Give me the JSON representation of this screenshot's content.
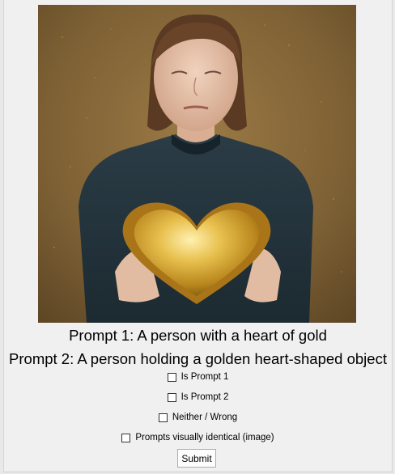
{
  "image": {
    "alt": ""
  },
  "prompts": {
    "prompt1": "Prompt 1: A person with a heart of gold",
    "prompt2": "Prompt 2: A person holding a golden heart-shaped object"
  },
  "options": {
    "is_prompt_1": "Is Prompt 1",
    "is_prompt_2": "Is Prompt 2",
    "neither": "Neither / Wrong",
    "identical": "Prompts visually identical (image)"
  },
  "submit_label": "Submit",
  "colors": {
    "background": "#f0f0f0",
    "gold": "#d9a93a",
    "sweater": "#24343d"
  }
}
